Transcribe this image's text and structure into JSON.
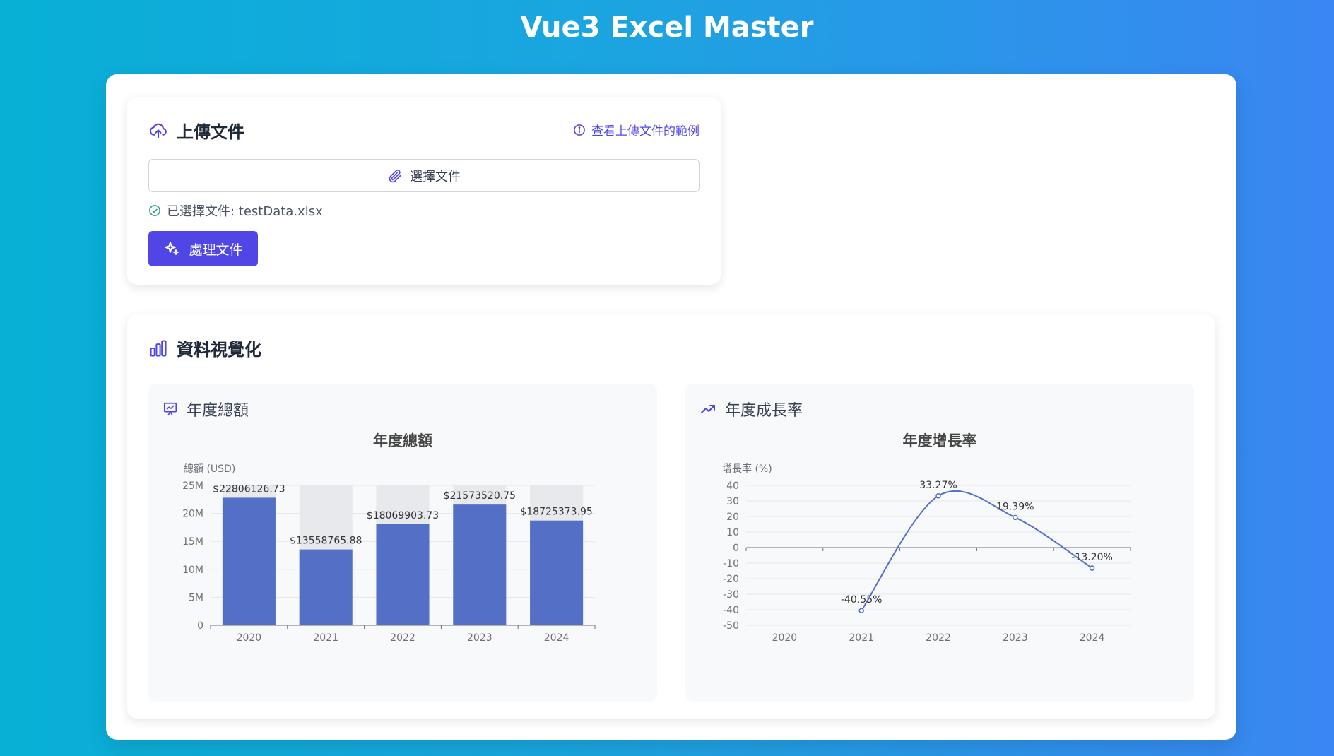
{
  "app": {
    "title": "Vue3 Excel Master"
  },
  "upload": {
    "title": "上傳文件",
    "example_link": "查看上傳文件的範例",
    "choose_label": "選擇文件",
    "selected_text": "已選擇文件: testData.xlsx",
    "process_label": "處理文件"
  },
  "viz": {
    "title": "資料視覺化",
    "panel_total": {
      "label": "年度總額"
    },
    "panel_growth": {
      "label": "年度成長率"
    }
  },
  "colors": {
    "accent": "#4f46e5",
    "series": "#5470c6",
    "success": "#22a06b",
    "bar_background": "#e8e9ec"
  },
  "icons": {
    "upload": "cloud-upload-icon",
    "info": "info-icon",
    "paperclip": "paperclip-icon",
    "check": "check-circle-icon",
    "sparkles": "sparkles-icon",
    "viz": "bar-chart-icon",
    "presentation": "presentation-chart-icon",
    "trend": "trending-up-icon"
  },
  "chart_data": [
    {
      "type": "bar",
      "title": "年度總額",
      "ylabel": "總額 (USD)",
      "categories": [
        "2020",
        "2021",
        "2022",
        "2023",
        "2024"
      ],
      "values": [
        22806126.73,
        13558765.88,
        18069903.73,
        21573520.75,
        18725373.95
      ],
      "data_labels": [
        "$22806126.73",
        "$13558765.88",
        "$18069903.73",
        "$21573520.75",
        "$18725373.95"
      ],
      "ylim": [
        0,
        25000000
      ],
      "yticks": [
        0,
        5000000,
        10000000,
        15000000,
        20000000,
        25000000
      ],
      "ytick_labels": [
        "0",
        "5M",
        "10M",
        "15M",
        "20M",
        "25M"
      ],
      "show_background_bars": true
    },
    {
      "type": "line",
      "title": "年度增長率",
      "ylabel": "增長率 (%)",
      "categories": [
        "2020",
        "2021",
        "2022",
        "2023",
        "2024"
      ],
      "x": [
        "2021",
        "2022",
        "2023",
        "2024"
      ],
      "values": [
        -40.55,
        33.27,
        19.39,
        -13.2
      ],
      "data_labels": [
        "-40.55%",
        "33.27%",
        "19.39%",
        "-13.20%"
      ],
      "ylim": [
        -50,
        40
      ],
      "yticks": [
        -50,
        -40,
        -30,
        -20,
        -10,
        0,
        10,
        20,
        30,
        40
      ],
      "smooth": true,
      "grid": true
    }
  ]
}
